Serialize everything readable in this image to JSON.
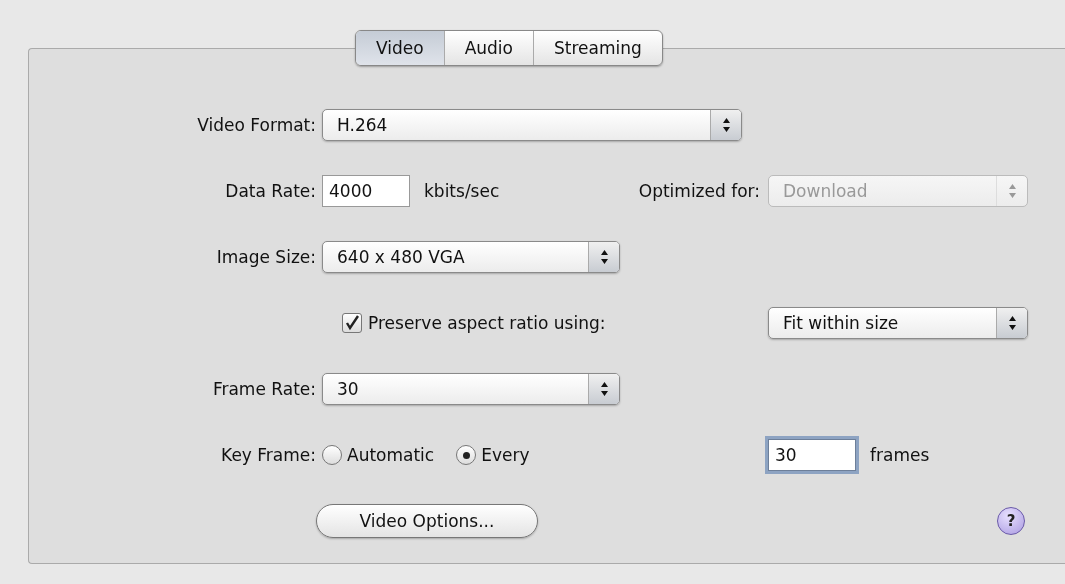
{
  "tabs": [
    {
      "label": "Video",
      "selected": true
    },
    {
      "label": "Audio",
      "selected": false
    },
    {
      "label": "Streaming",
      "selected": false
    }
  ],
  "video_format": {
    "label": "Video Format:",
    "value": "H.264"
  },
  "data_rate": {
    "label": "Data Rate:",
    "value": "4000",
    "unit": "kbits/sec"
  },
  "optimized_for": {
    "label": "Optimized for:",
    "value": "Download",
    "disabled": true
  },
  "image_size": {
    "label": "Image Size:",
    "value": "640 x 480 VGA"
  },
  "preserve_aspect": {
    "label": "Preserve aspect ratio using:",
    "checked": true,
    "value": "Fit within size"
  },
  "frame_rate": {
    "label": "Frame Rate:",
    "value": "30"
  },
  "key_frame": {
    "label": "Key Frame:",
    "options": [
      {
        "label": "Automatic",
        "selected": false
      },
      {
        "label": "Every",
        "selected": true
      }
    ],
    "value": "30",
    "focused": true,
    "unit": "frames"
  },
  "video_options_button": "Video Options...",
  "help": "?"
}
